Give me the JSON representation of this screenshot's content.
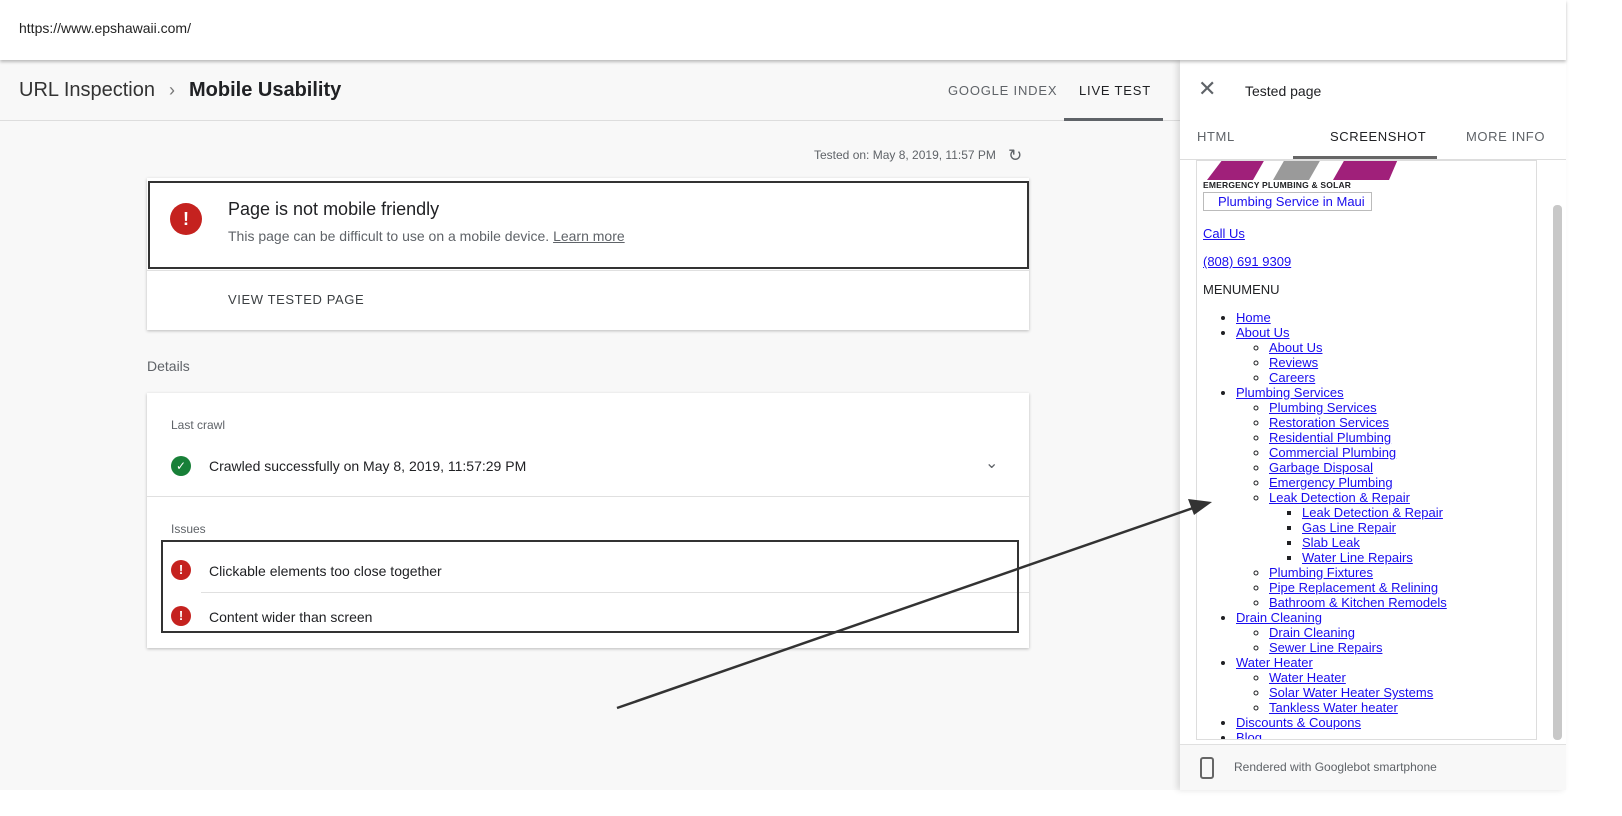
{
  "url": "https://www.epshawaii.com/",
  "breadcrumb": {
    "parent": "URL Inspection",
    "current": "Mobile Usability"
  },
  "tabs": [
    {
      "label": "GOOGLE INDEX"
    },
    {
      "label": "LIVE TEST",
      "active": true
    }
  ],
  "tested_on": "Tested on: May 8, 2019, 11:57 PM",
  "result": {
    "title": "Page is not mobile friendly",
    "desc": "This page can be difficult to use on a mobile device.",
    "learn_more": "Learn more",
    "view_button": "VIEW TESTED PAGE"
  },
  "details_label": "Details",
  "last_crawl": {
    "label": "Last crawl",
    "text": "Crawled successfully on May 8, 2019, 11:57:29 PM"
  },
  "issues": {
    "label": "Issues",
    "items": [
      "Clickable elements too close together",
      "Content wider than screen"
    ]
  },
  "panel": {
    "title": "Tested page",
    "tabs": [
      {
        "label": "HTML"
      },
      {
        "label": "SCREENSHOT",
        "active": true
      },
      {
        "label": "MORE INFO"
      }
    ],
    "footer": "Rendered with Googlebot smartphone"
  },
  "site": {
    "logo_text": "EMERGENCY PLUMBING & SOLAR",
    "tagline": "Plumbing Service in Maui",
    "call": "Call Us",
    "phone": "(808) 691 9309",
    "menu": "MENUMENU",
    "nav": [
      {
        "label": "Home"
      },
      {
        "label": "About Us",
        "children": [
          {
            "label": "About Us"
          },
          {
            "label": "Reviews"
          },
          {
            "label": "Careers"
          }
        ]
      },
      {
        "label": "Plumbing Services",
        "children": [
          {
            "label": "Plumbing Services"
          },
          {
            "label": "Restoration Services"
          },
          {
            "label": "Residential Plumbing"
          },
          {
            "label": "Commercial Plumbing"
          },
          {
            "label": "Garbage Disposal"
          },
          {
            "label": "Emergency Plumbing"
          },
          {
            "label": "Leak Detection & Repair",
            "children": [
              {
                "label": "Leak Detection & Repair"
              },
              {
                "label": "Gas Line Repair"
              },
              {
                "label": "Slab Leak"
              },
              {
                "label": "Water Line Repairs"
              }
            ]
          },
          {
            "label": "Plumbing Fixtures"
          },
          {
            "label": "Pipe Replacement & Relining"
          },
          {
            "label": "Bathroom & Kitchen Remodels"
          }
        ]
      },
      {
        "label": "Drain Cleaning",
        "children": [
          {
            "label": "Drain Cleaning"
          },
          {
            "label": "Sewer Line Repairs"
          }
        ]
      },
      {
        "label": "Water Heater",
        "children": [
          {
            "label": "Water Heater"
          },
          {
            "label": "Solar Water Heater Systems"
          },
          {
            "label": "Tankless Water heater"
          }
        ]
      },
      {
        "label": "Discounts & Coupons"
      },
      {
        "label": "Blog"
      }
    ]
  },
  "colors": {
    "error": "#c5221f",
    "success": "#188038",
    "link": "#1a0dee",
    "logo": "#a0207a"
  }
}
